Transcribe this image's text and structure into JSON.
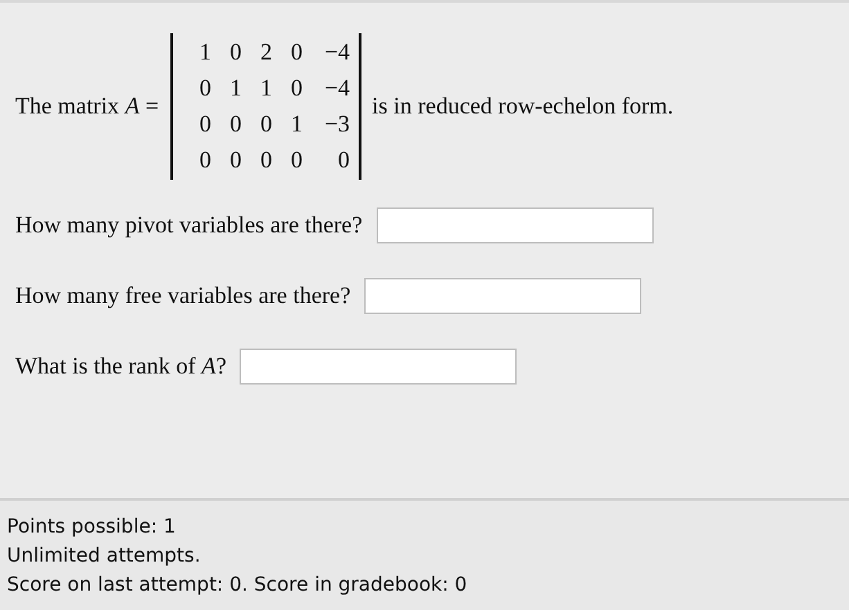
{
  "statement": {
    "prefix": "The matrix *A* =",
    "suffix": "is in reduced row-echelon form.",
    "matrix": [
      [
        "1",
        "0",
        "2",
        "0",
        "−4"
      ],
      [
        "0",
        "1",
        "1",
        "0",
        "−4"
      ],
      [
        "0",
        "0",
        "0",
        "1",
        "−3"
      ],
      [
        "0",
        "0",
        "0",
        "0",
        "0"
      ]
    ]
  },
  "questions": [
    {
      "text": "How many pivot variables are there?"
    },
    {
      "text": "How many free variables are there?"
    },
    {
      "text": "What is the rank of *A*?"
    }
  ],
  "footer": [
    "Points possible: 1",
    "Unlimited attempts.",
    "Score on last attempt: 0. Score in gradebook: 0"
  ]
}
